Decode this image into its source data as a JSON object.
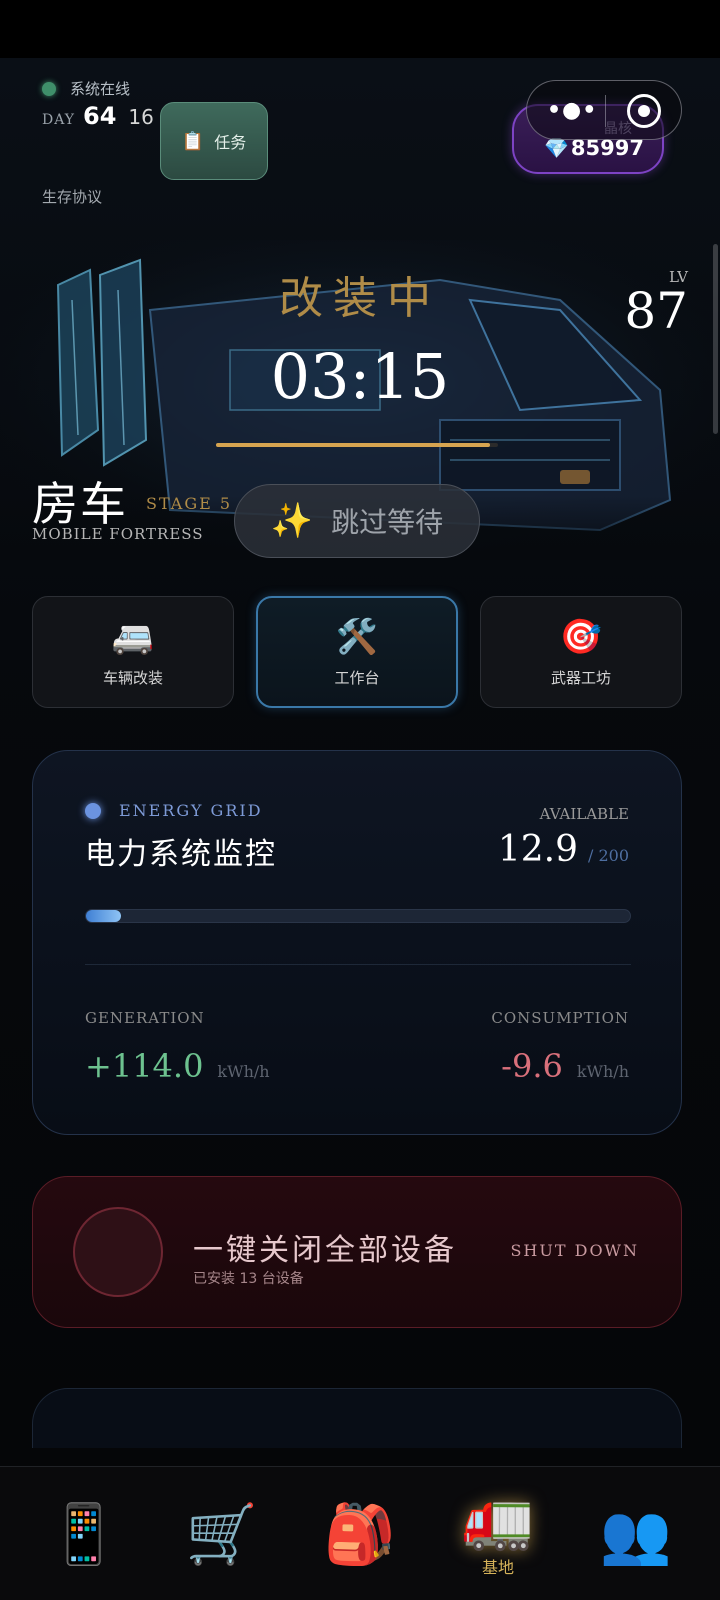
{
  "status": {
    "online_text": "系统在线",
    "day_label": "DAY",
    "day_number": "64",
    "day_sub": "16",
    "protocol": "生存协议"
  },
  "task_button": {
    "icon": "clipboard-icon",
    "label": "任务"
  },
  "crystal": {
    "label": "晶核",
    "value": "85997",
    "icon": "gem-icon"
  },
  "hero": {
    "title": "改装中",
    "timer": "03:15",
    "progress_fraction": 0.97,
    "level_label": "LV",
    "level": "87",
    "vehicle_name": "房车",
    "stage": "STAGE 5",
    "vehicle_en": "MOBILE FORTRESS",
    "skip_label": "跳过等待",
    "skip_icon": "sparkles-icon"
  },
  "tabs": [
    {
      "label": "车辆改装",
      "icon": "🚐",
      "active": false
    },
    {
      "label": "工作台",
      "icon": "🛠️",
      "active": true
    },
    {
      "label": "武器工坊",
      "icon": "🎯",
      "active": false
    }
  ],
  "energy": {
    "tag": "ENERGY GRID",
    "title": "电力系统监控",
    "available_label": "AVAILABLE",
    "available_value": "12.9",
    "available_max": "/ 200",
    "bar_fraction": 0.065,
    "generation_label": "GENERATION",
    "generation_value": "+114.0",
    "consumption_label": "CONSUMPTION",
    "consumption_value": "-9.6",
    "unit": "kWh/h",
    "accent": "#6b93e0"
  },
  "shutdown": {
    "title": "一键关闭全部设备",
    "subtitle": "已安装  13  台设备",
    "action": "SHUT DOWN"
  },
  "nav": [
    {
      "icon": "📱",
      "label": ""
    },
    {
      "icon": "🛒",
      "label": ""
    },
    {
      "icon": "🎒",
      "label": ""
    },
    {
      "icon": "🚛",
      "label": "基地",
      "active": true
    },
    {
      "icon": "👥",
      "label": ""
    }
  ],
  "colors": {
    "gold": "#b08c48",
    "online": "#3f8f6a",
    "generation": "#6dc28f",
    "consumption": "#d9707b"
  }
}
